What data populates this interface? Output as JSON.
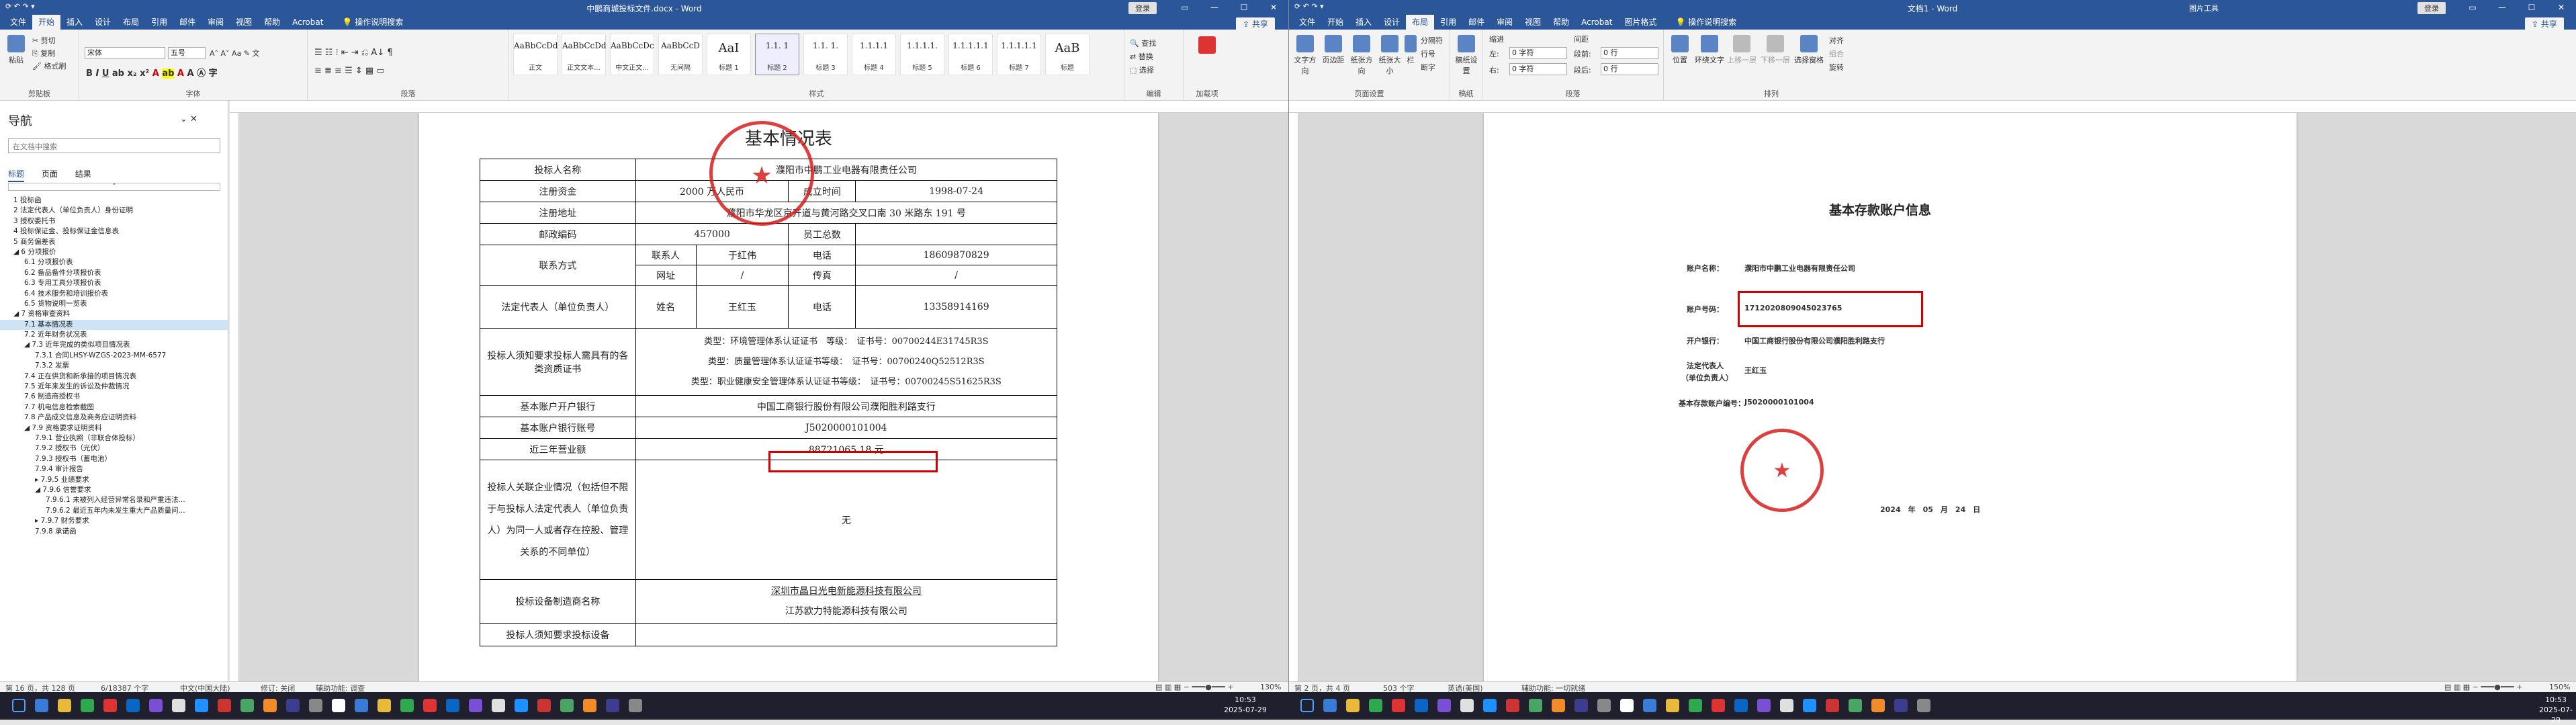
{
  "left": {
    "title": "中鹏商城投标文件.docx - Word",
    "login": "登录",
    "share": "共享",
    "tabs": [
      "文件",
      "开始",
      "插入",
      "设计",
      "布局",
      "引用",
      "邮件",
      "审阅",
      "视图",
      "帮助",
      "Acrobat"
    ],
    "tell": "操作说明搜索",
    "ribbon": {
      "paste": "粘贴",
      "cut": "剪切",
      "copy": "复制",
      "format_painter": "格式刷",
      "clipboard": "剪贴板",
      "font_name": "宋体",
      "font_size": "五号",
      "font": "字体",
      "paragraph": "段落",
      "styles": [
        {
          "preview": "AaBbCcDd",
          "name": "正文"
        },
        {
          "preview": "AaBbCcDd",
          "name": "正文文本..."
        },
        {
          "preview": "AaBbCcDc",
          "name": "中文正文..."
        },
        {
          "preview": "AaBbCcD",
          "name": "无间隔"
        },
        {
          "preview": "AaI",
          "name": "标题 1"
        },
        {
          "preview": "1.1. 1",
          "name": "标题 2"
        },
        {
          "preview": "1.1. 1.",
          "name": "标题 3"
        },
        {
          "preview": "1.1.1.1",
          "name": "标题 4"
        },
        {
          "preview": "1.1.1.1.",
          "name": "标题 5"
        },
        {
          "preview": "1.1.1.1.1",
          "name": "标题 6"
        },
        {
          "preview": "1.1.1.1.1",
          "name": "标题 7"
        },
        {
          "preview": "AaB",
          "name": "标题"
        }
      ],
      "style_label": "样式",
      "find": "查找",
      "replace": "替换",
      "select": "选择",
      "editing": "编辑",
      "acrobat_load": "加载项"
    },
    "nav": {
      "title": "导航",
      "search_placeholder": "在文档中搜索",
      "tabs": [
        "标题",
        "页面",
        "结果"
      ],
      "items": [
        {
          "t": "1 投标函",
          "i": 1
        },
        {
          "t": "2 法定代表人（单位负责人）身份证明",
          "i": 1
        },
        {
          "t": "3 授权委托书",
          "i": 1
        },
        {
          "t": "4 投标保证金、投标保证金信息表",
          "i": 1
        },
        {
          "t": "5 商务偏差表",
          "i": 1
        },
        {
          "t": "◢ 6 分项报价",
          "i": 1
        },
        {
          "t": "6.1 分项报价表",
          "i": 2
        },
        {
          "t": "6.2 备品备件分项报价表",
          "i": 2
        },
        {
          "t": "6.3 专用工具分项报价表",
          "i": 2
        },
        {
          "t": "6.4 技术服务和培训报价表",
          "i": 2
        },
        {
          "t": "6.5 货物说明一览表",
          "i": 2
        },
        {
          "t": "◢ 7 资格审查资料",
          "i": 1
        },
        {
          "t": "7.1 基本情况表",
          "i": 2,
          "sel": true
        },
        {
          "t": "7.2 近年财务状况表",
          "i": 2
        },
        {
          "t": "◢ 7.3 近年完成的类似项目情况表",
          "i": 2
        },
        {
          "t": "7.3.1 合同LHSY-WZGS-2023-MM-6577",
          "i": 3
        },
        {
          "t": "7.3.2 发票",
          "i": 3
        },
        {
          "t": "7.4 正在供货和新承接的项目情况表",
          "i": 2
        },
        {
          "t": "7.5 近年来发生的诉讼及仲裁情况",
          "i": 2
        },
        {
          "t": "7.6 制造商授权书",
          "i": 2
        },
        {
          "t": "7.7 机电信息检索截图",
          "i": 2
        },
        {
          "t": "7.8 产品成交信息及商务应证明资料",
          "i": 2
        },
        {
          "t": "◢ 7.9 资格要求证明资料",
          "i": 2
        },
        {
          "t": "7.9.1 营业执照（非联合体投标）",
          "i": 3
        },
        {
          "t": "7.9.2 授权书（光伏）",
          "i": 3
        },
        {
          "t": "7.9.3 授权书（蓄电池）",
          "i": 3
        },
        {
          "t": "7.9.4 审计报告",
          "i": 3
        },
        {
          "t": "▸ 7.9.5 业绩要求",
          "i": 3
        },
        {
          "t": "◢ 7.9.6 信誉要求",
          "i": 3
        },
        {
          "t": "7.9.6.1 未被列入经营异常名录和严重违法...",
          "i": 4
        },
        {
          "t": "7.9.6.2 最近五年内未发生重大产品质量问...",
          "i": 4
        },
        {
          "t": "▸ 7.9.7 财务要求",
          "i": 3
        },
        {
          "t": "7.9.8 承诺函",
          "i": 3
        }
      ]
    },
    "doc": {
      "heading": "基本情况表",
      "rows": {
        "bidder_label": "投标人名称",
        "bidder_value": "濮阳市中鹏工业电器有限责任公司",
        "capital_label": "注册资金",
        "capital_value": "2000 万人民币",
        "founded_label": "成立时间",
        "founded_value": "1998-07-24",
        "address_label": "注册地址",
        "address_value": "濮阳市华龙区京开道与黄河路交叉口南 30 米路东 191 号",
        "zip_label": "邮政编码",
        "zip_value": "457000",
        "staff_label": "员工总数",
        "staff_value": "",
        "contact_label": "联系方式",
        "contact_person_label": "联系人",
        "contact_person": "于红伟",
        "phone_label": "电话",
        "phone": "18609870829",
        "web_label": "网址",
        "web_value": "/",
        "fax_label": "传真",
        "fax_value": "/",
        "legal_label": "法定代表人（单位负责人）",
        "name_label": "姓名",
        "legal_name": "王红玉",
        "legal_phone_label": "电话",
        "legal_phone": "13358914169",
        "cert_label": "投标人须知要求投标人需具有的各类资质证书",
        "cert1": "类型：环境管理体系认证证书　等级：　证书号：00700244E31745R3S",
        "cert2": "类型：质量管理体系认证证书等级：　证书号：00700240Q52512R3S",
        "cert3": "类型：职业健康安全管理体系认证证书等级：　证书号：00700245S51625R3S",
        "bank_label": "基本账户开户银行",
        "bank_value": "中国工商银行股份有限公司濮阳胜利路支行",
        "account_label": "基本账户银行账号",
        "account_value": "J5020000101004",
        "revenue_label": "近三年营业额",
        "revenue_value": "88721065.18 元",
        "related_label": "投标人关联企业情况（包括但不限于与投标人法定代表人（单位负责人）为同一人或者存在控股、管理关系的不同单位）",
        "related_value": "无",
        "mfr_label": "投标设备制造商名称",
        "mfr1": "深圳市晶日光电新能源科技有限公司",
        "mfr2": "江苏欧力特能源科技有限公司",
        "last_label": "投标人须知要求投标设备"
      }
    },
    "status": {
      "page": "第 16 页，共 128 页",
      "words": "6/18387 个字",
      "lang": "英语(中国台湾)",
      "input": "中文(中国大陆)",
      "macro": "修订: 关闭",
      "access": "辅助功能: 调查",
      "zoom": "130%"
    }
  },
  "right": {
    "title": "文档1 - Word",
    "picture_format": "图片工具",
    "login": "登录",
    "share": "共享",
    "tabs": [
      "文件",
      "开始",
      "插入",
      "设计",
      "布局",
      "引用",
      "邮件",
      "审阅",
      "视图",
      "帮助",
      "Acrobat",
      "图片格式"
    ],
    "tell": "操作说明搜索",
    "ribbon": {
      "text_direction": "文字方向",
      "margins": "页边距",
      "orientation": "纸张方向",
      "size": "纸张大小",
      "columns": "栏",
      "breaks": "分隔符",
      "line_numbers": "行号",
      "hyphenation": "断字",
      "page_setup": "页面设置",
      "indent": "缩进",
      "spacing": "间距",
      "left": "左:",
      "right": "右:",
      "before": "段前:",
      "after": "段后:",
      "indent_left": "0 字符",
      "indent_right": "0 字符",
      "space_before": "0 行",
      "space_after": "0 行",
      "paragraph": "段落",
      "position": "位置",
      "wrap": "环绕文字",
      "forward": "上移一层",
      "backward": "下移一层",
      "sel_pane": "选择窗格",
      "align": "对齐",
      "group": "组合",
      "rotate": "旋转",
      "arrange": "排列",
      "draft": "稿纸设置",
      "draft_group": "稿纸"
    },
    "doc": {
      "heading": "基本存款账户信息",
      "name_label": "账户名称：",
      "name_value": "濮阳市中鹏工业电器有限责任公司",
      "acct_label": "账户号码：",
      "acct_value": "1712020809045023765",
      "bank_label": "开户银行：",
      "bank_value": "中国工商银行股份有限公司濮阳胜利路支行",
      "legal_label1": "法定代表人",
      "legal_label2": "（单位负责人）",
      "legal_value": "王红玉",
      "basic_label": "基本存款账户编号：",
      "basic_value": "J5020000101004",
      "date": "2024　年　05　月　24　日"
    },
    "status": {
      "page": "第 2 页，共 4 页",
      "words": "503 个字",
      "lang": "英语(美国)",
      "access": "辅助功能: 一切就绪",
      "zoom": "150%"
    }
  },
  "taskbar": {
    "time1": "10:53",
    "date1": "2025-07-29",
    "time2": "10:53",
    "date2": "2025-07-29"
  },
  "colors": {
    "word_blue": "#2b579a",
    "seal_red": "#d81e1e",
    "highlight_box": "#d40000"
  }
}
